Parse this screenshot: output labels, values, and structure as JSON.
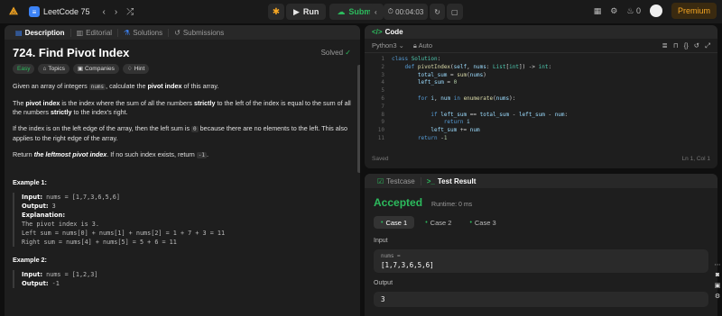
{
  "topbar": {
    "list_title": "LeetCode 75",
    "run_label": "Run",
    "submit_label": "Submit",
    "timer": "00:04:03",
    "fire_count": "0",
    "premium_label": "Premium"
  },
  "left_tabs": [
    {
      "label": "Description"
    },
    {
      "label": "Editorial"
    },
    {
      "label": "Solutions"
    },
    {
      "label": "Submissions"
    }
  ],
  "problem": {
    "title": "724. Find Pivot Index",
    "status": "Solved",
    "chips": {
      "difficulty": "Easy",
      "topics": "Topics",
      "companies": "Companies",
      "hint": "Hint"
    }
  },
  "description": {
    "p1": [
      "Given an array of integers ",
      "nums",
      ", calculate the ",
      "pivot index",
      " of this array."
    ],
    "p2": [
      "The ",
      "pivot index",
      " is the index where the sum of all the numbers ",
      "strictly",
      " to the left of the index is equal to the sum of all the numbers ",
      "strictly",
      " to the index's right."
    ],
    "p3": [
      "If the index is on the left edge of the array, then the left sum is ",
      "0",
      " because there are no elements to the left. This also applies to the right edge of the array."
    ],
    "p4": [
      "Return ",
      "the leftmost pivot index",
      ". If no such index exists, return ",
      "-1",
      "."
    ]
  },
  "examples": [
    {
      "title": "Example 1:",
      "input_label": "Input:",
      "input": " nums = [1,7,3,6,5,6]",
      "output_label": "Output:",
      "output": " 3",
      "explanation_label": "Explanation:",
      "explanation": [
        "The pivot index is 3.",
        "Left sum = nums[0] + nums[1] + nums[2] = 1 + 7 + 3 = 11",
        "Right sum = nums[4] + nums[5] = 5 + 6 = 11"
      ]
    },
    {
      "title": "Example 2:",
      "input_label": "Input:",
      "input": " nums = [1,2,3]",
      "output_label": "Output:",
      "output": " -1"
    }
  ],
  "code_panel": {
    "tab_label": "Code",
    "language": "Python3",
    "mode": "Auto",
    "saved": "Saved",
    "cursor": "Ln 1, Col 1"
  },
  "code_lines": [
    "1",
    "2",
    "3",
    "4",
    "5",
    "6",
    "7",
    "8",
    "9",
    "10",
    "11"
  ],
  "test_panel": {
    "tab_testcase": "Testcase",
    "tab_result": "Test Result",
    "verdict": "Accepted",
    "runtime": "Runtime: 0 ms",
    "cases": [
      "Case 1",
      "Case 2",
      "Case 3"
    ],
    "input_label": "Input",
    "input_key": "nums =",
    "input_value": "[1,7,3,6,5,6]",
    "output_label": "Output",
    "output_value": "3"
  },
  "colors": {
    "accent_green": "#2cbb5d",
    "accent_orange": "#f5a623",
    "link_blue": "#3b82f6"
  },
  "icons": [
    "logo-icon",
    "list-icon",
    "chevron-left-icon",
    "chevron-right-icon",
    "shuffle-icon",
    "debug-icon",
    "play-icon",
    "cloud-upload-icon",
    "timer-icon",
    "reset-icon",
    "note-icon",
    "grid-icon",
    "gear-icon",
    "fire-icon",
    "avatar",
    "description-icon",
    "editorial-icon",
    "solutions-icon",
    "submissions-icon",
    "check-icon",
    "tag-icon",
    "building-icon",
    "bulb-icon",
    "code-icon",
    "lock-icon",
    "format-icon",
    "bookmark-icon",
    "braces-icon",
    "undo-icon",
    "expand-icon",
    "testcase-icon",
    "terminal-icon",
    "camera-icon",
    "image-icon",
    "gear-icon"
  ]
}
